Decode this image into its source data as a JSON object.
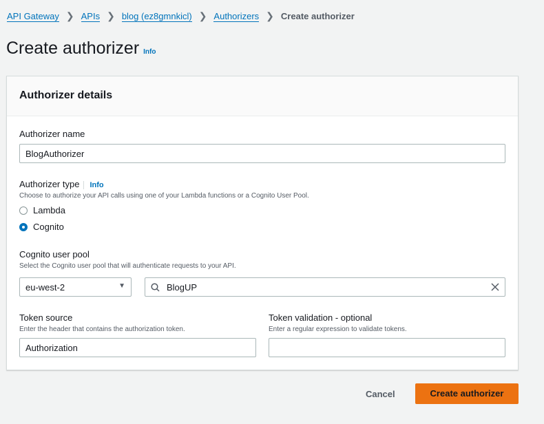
{
  "breadcrumb": {
    "items": [
      "API Gateway",
      "APIs",
      "blog (ez8gmnkicl)",
      "Authorizers"
    ],
    "current": "Create authorizer"
  },
  "page": {
    "title": "Create authorizer",
    "info": "Info"
  },
  "panel": {
    "title": "Authorizer details"
  },
  "name": {
    "label": "Authorizer name",
    "value": "BlogAuthorizer"
  },
  "type": {
    "label": "Authorizer type",
    "info": "Info",
    "description": "Choose to authorize your API calls using one of your Lambda functions or a Cognito User Pool.",
    "options": [
      "Lambda",
      "Cognito"
    ],
    "selected": "Cognito"
  },
  "pool": {
    "label": "Cognito user pool",
    "description": "Select the Cognito user pool that will authenticate requests to your API.",
    "region": "eu-west-2",
    "search_value": "BlogUP"
  },
  "token_source": {
    "label": "Token source",
    "description": "Enter the header that contains the authorization token.",
    "value": "Authorization"
  },
  "token_validation": {
    "label": "Token validation - optional",
    "description": "Enter a regular expression to validate tokens.",
    "value": ""
  },
  "actions": {
    "cancel": "Cancel",
    "create": "Create authorizer"
  },
  "colors": {
    "primary": "#ec7211",
    "link": "#0073bb"
  }
}
